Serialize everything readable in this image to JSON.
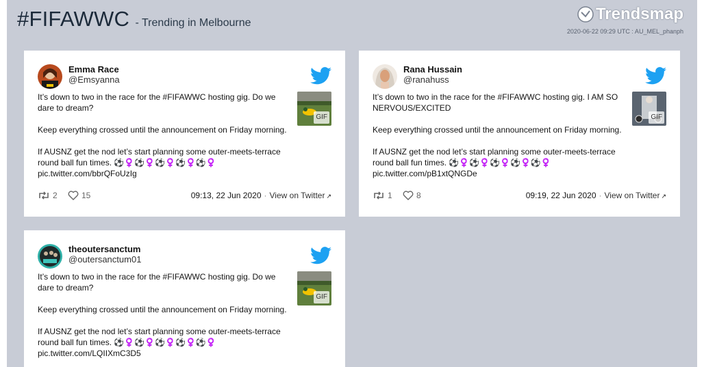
{
  "header": {
    "hashtag": "#FIFAWWC",
    "subtitle": "- Trending in Melbourne",
    "logo_text": "Trendsmap",
    "timestamp": "2020-06-22 09:29 UTC : AU_MEL_phanph"
  },
  "tweets": [
    {
      "name": "Emma Race",
      "handle": "@Emsyanna",
      "paragraphs": [
        "It’s down to two in the race for the #FIFAWWC hosting gig. Do we dare to dream?",
        "Keep everything crossed until the announcement on Friday morning.",
        "If AUSNZ get the nod let’s start planning some outer-meets-terrace round ball fun times. ⚽️♀️⚽️♀️⚽️♀️⚽️♀️⚽️♀️",
        "pic.twitter.com/bbrQFoUzIg"
      ],
      "media_badge": "GIF",
      "retweets": "2",
      "likes": "15",
      "time": "09:13, 22 Jun 2020",
      "view_link": "View on Twitter"
    },
    {
      "name": "Rana Hussain",
      "handle": "@ranahuss",
      "paragraphs": [
        "It’s down to two in the race for the #FIFAWWC hosting gig. I AM SO NERVOUS/EXCITED",
        "Keep everything crossed until the announcement on Friday morning.",
        "If AUSNZ get the nod let’s start planning some outer-meets-terrace round ball fun times. ⚽️♀️⚽️♀️⚽️♀️⚽️♀️⚽️♀️",
        "pic.twitter.com/pB1xtQNGDe"
      ],
      "media_badge": "GIF",
      "retweets": "1",
      "likes": "8",
      "time": "09:19, 22 Jun 2020",
      "view_link": "View on Twitter"
    },
    {
      "name": "theoutersanctum",
      "handle": "@outersanctum01",
      "paragraphs": [
        "It’s down to two in the race for the #FIFAWWC hosting gig. Do we dare to dream?",
        "Keep everything crossed until the announcement on Friday morning.",
        "If AUSNZ get the nod let’s start planning some outer-meets-terrace round ball fun times. ⚽️♀️⚽️♀️⚽️♀️⚽️♀️⚽️♀️",
        "pic.twitter.com/LQIIXmC3D5"
      ],
      "media_badge": "GIF"
    }
  ],
  "colors": {
    "page_bg": "#c8ccd6",
    "twitter_blue": "#1da1f2"
  }
}
